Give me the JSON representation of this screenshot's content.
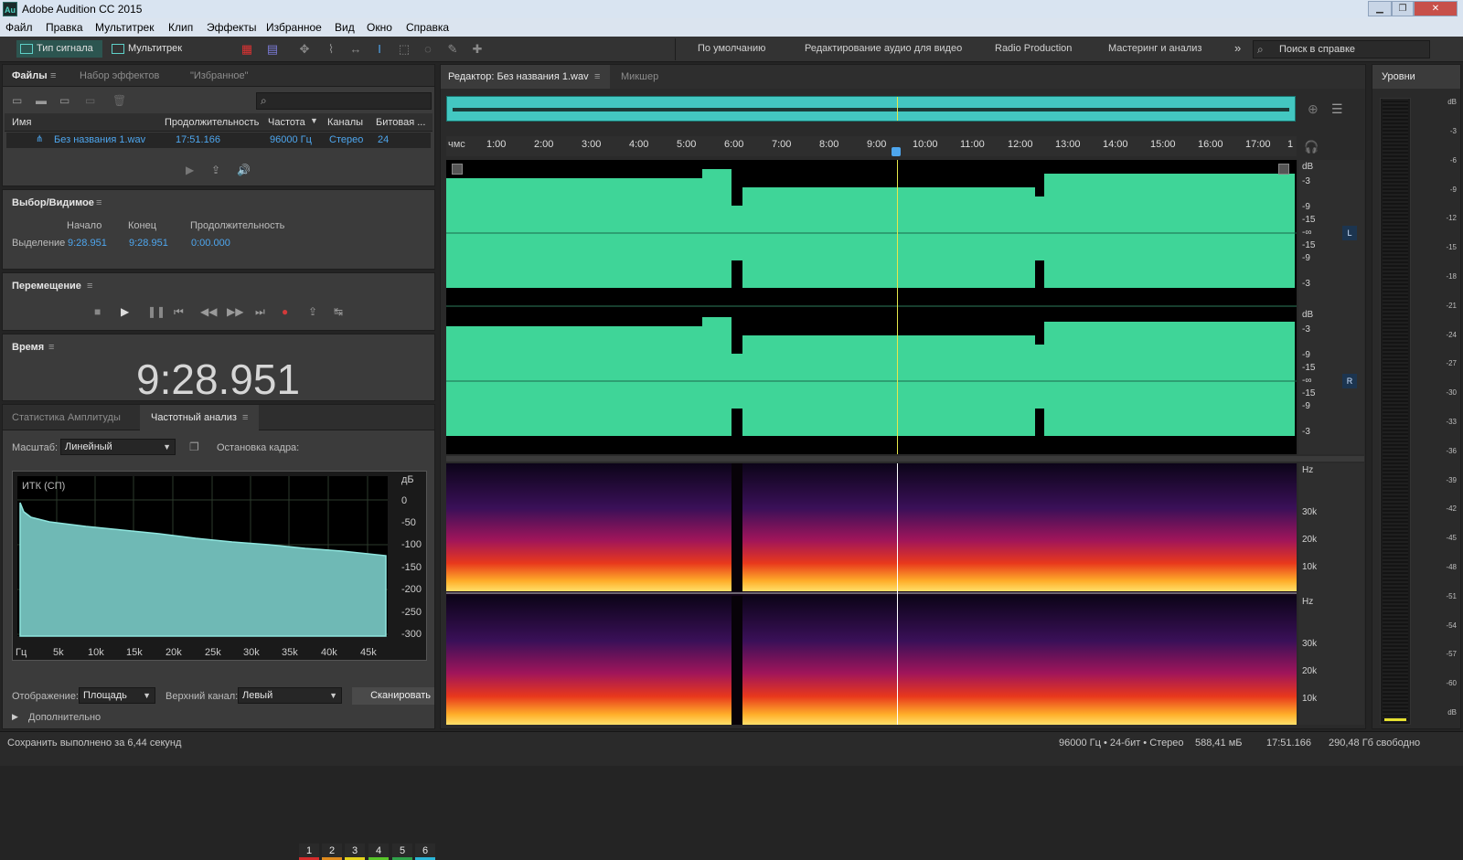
{
  "window": {
    "app_title": "Adobe Audition CC 2015",
    "logo_text": "Au"
  },
  "menu": [
    "Файл",
    "Правка",
    "Мультитрек",
    "Клип",
    "Эффекты",
    "Избранное",
    "Вид",
    "Окно",
    "Справка"
  ],
  "toolbar": {
    "waveform_label": "Тип сигнала",
    "multitrack_label": "Мультитрек",
    "workspaces": [
      "По умолчанию",
      "Редактирование аудио для видео",
      "Radio Production",
      "Мастеринг и анализ"
    ],
    "overflow": "»",
    "search_placeholder": "Поиск в справке"
  },
  "files_panel": {
    "tabs": [
      "Файлы",
      "Набор эффектов",
      "\"Избранное\""
    ],
    "columns": [
      "Имя",
      "Продолжительность",
      "Частота",
      "Каналы",
      "Битовая ..."
    ],
    "rows": [
      {
        "name": "Без названия 1.wav",
        "duration": "17:51.166",
        "rate": "96000 Гц",
        "channels": "Стерео",
        "bits": "24"
      }
    ]
  },
  "selection_panel": {
    "title": "Выбор/Видимое",
    "col_start": "Начало",
    "col_end": "Конец",
    "col_duration": "Продолжительность",
    "row_label": "Выделение",
    "start": "9:28.951",
    "end": "9:28.951",
    "duration": "0:00.000"
  },
  "transport_panel": {
    "title": "Перемещение"
  },
  "time_panel": {
    "title": "Время",
    "display": "9:28.951"
  },
  "analysis_panel": {
    "tabs": [
      "Статистика Амплитуды",
      "Частотный анализ"
    ],
    "scale_label": "Масштаб:",
    "scale_value": "Линейный",
    "freeze_label": "Остановка кадра:",
    "freeze_slots": [
      {
        "label": "1",
        "color": "#d62b2b"
      },
      {
        "label": "2",
        "color": "#e08a1c"
      },
      {
        "label": "3",
        "color": "#e3d21a"
      },
      {
        "label": "4",
        "color": "#59c62a"
      },
      {
        "label": "5",
        "color": "#2fa24a"
      },
      {
        "label": "6",
        "color": "#2bb6d8"
      }
    ],
    "graph_label": "ИТК (СП)",
    "db_unit": "дБ",
    "db_ticks": [
      "0",
      "-50",
      "-100",
      "-150",
      "-200",
      "-250",
      "-300"
    ],
    "hz_ticks": [
      "Гц",
      "5k",
      "10k",
      "15k",
      "20k",
      "25k",
      "30k",
      "35k",
      "40k",
      "45k"
    ],
    "display_label": "Отображение:",
    "display_value": "Площадь",
    "top_channel_label": "Верхний канал:",
    "top_channel_value": "Левый",
    "scan_label": "Сканировать",
    "advanced_label": "Дополнительно"
  },
  "editor": {
    "tab_label": "Редактор: Без названия 1.wav",
    "mixer_label": "Микшер",
    "ruler_unit": "чмс",
    "ruler_ticks": [
      "1:00",
      "2:00",
      "3:00",
      "4:00",
      "5:00",
      "6:00",
      "7:00",
      "8:00",
      "9:00",
      "10:00",
      "11:00",
      "12:00",
      "13:00",
      "14:00",
      "15:00",
      "16:00",
      "17:00",
      "1"
    ],
    "db_scale": [
      "dB",
      "-3",
      "-9",
      "-15",
      "-∞",
      "-15",
      "-9",
      "-3"
    ],
    "channel_left": "L",
    "channel_right": "R",
    "hz_label": "Hz",
    "hz_ticks": [
      "30k",
      "20k",
      "10k"
    ],
    "waveform_color": "#3fd598",
    "playhead_color": "#e6e84a"
  },
  "levels_panel": {
    "title": "Уровни",
    "scale": [
      "dB",
      "-3",
      "-6",
      "-9",
      "-12",
      "-15",
      "-18",
      "-21",
      "-24",
      "-27",
      "-30",
      "-33",
      "-36",
      "-39",
      "-42",
      "-45",
      "-48",
      "-51",
      "-54",
      "-57",
      "-60",
      "dB"
    ]
  },
  "status_bar": {
    "message": "Сохранить выполнено за 6,44 секунд",
    "format": "96000 Гц • 24-бит • Стерео",
    "size": "588,41 мБ",
    "duration": "17:51.166",
    "free": "290,48 Гб свободно"
  }
}
